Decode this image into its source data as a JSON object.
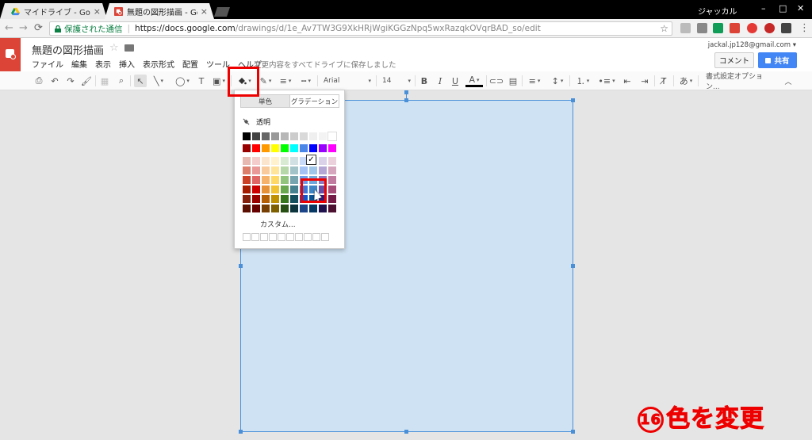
{
  "browser": {
    "tabs": [
      {
        "title": "マイドライブ - Google ドライブ",
        "active": false,
        "favicon": "drive-icon"
      },
      {
        "title": "無題の図形描画 - Google ドロー",
        "active": true,
        "favicon": "drawings-icon"
      }
    ],
    "window_user": "ジャッカル",
    "secure_label": "保護された通信",
    "url_host": "https://docs.google.com",
    "url_path": "/drawings/d/1e_Av7TW3G9XkHRjWgiKGGzNpq5wxRazqkOVqrBAD_so/edit",
    "extension_badges": [
      "2",
      "4"
    ]
  },
  "app": {
    "title": "無題の図形描画",
    "menu": [
      "ファイル",
      "編集",
      "表示",
      "挿入",
      "表示形式",
      "配置",
      "ツール",
      "ヘルプ"
    ],
    "save_status": "変更内容をすべてドライブに保存しました",
    "account": "jackal.jp128@gmail.com",
    "comment_label": "コメント",
    "share_label": "共有"
  },
  "toolbar": {
    "font_name": "Arial",
    "font_size": "14",
    "bold": "B",
    "italic": "I",
    "underline": "U",
    "text_color": "A",
    "input_tools": "あ",
    "format_options": "書式設定オプション..."
  },
  "color_menu": {
    "tabs": [
      "単色",
      "グラデーション"
    ],
    "transparent_label": "透明",
    "custom_label": "カスタム...",
    "check_mark": "✓",
    "rows": [
      [
        "#000000",
        "#434343",
        "#666666",
        "#999999",
        "#b7b7b7",
        "#cccccc",
        "#d9d9d9",
        "#efefef",
        "#f3f3f3",
        "#ffffff"
      ],
      [
        "#980000",
        "#ff0000",
        "#ff9900",
        "#ffff00",
        "#00ff00",
        "#00ffff",
        "#4a86e8",
        "#0000ff",
        "#9900ff",
        "#ff00ff"
      ],
      [
        "#e6b8af",
        "#f4cccc",
        "#fce5cd",
        "#fff2cc",
        "#d9ead3",
        "#d0e0e3",
        "#c9daf8",
        "#cfe2f3",
        "#d9d2e9",
        "#ead1dc"
      ],
      [
        "#dd7e6b",
        "#ea9999",
        "#f9cb9c",
        "#ffe599",
        "#b6d7a8",
        "#a2c4c9",
        "#a4c2f4",
        "#9fc5e8",
        "#b4a7d6",
        "#d5a6bd"
      ],
      [
        "#cc4125",
        "#e06666",
        "#f6b26b",
        "#ffd966",
        "#93c47d",
        "#76a5af",
        "#6d9eeb",
        "#6fa8dc",
        "#8e7cc3",
        "#c27ba0"
      ],
      [
        "#a61c00",
        "#cc0000",
        "#e69138",
        "#f1c232",
        "#6aa84f",
        "#45818e",
        "#3c78d8",
        "#3d85c6",
        "#674ea7",
        "#a64d79"
      ],
      [
        "#85200c",
        "#990000",
        "#b45f06",
        "#bf9000",
        "#38761d",
        "#134f5c",
        "#1155cc",
        "#0b5394",
        "#351c75",
        "#741b47"
      ],
      [
        "#5b0f00",
        "#660000",
        "#783f04",
        "#7f6000",
        "#274e13",
        "#0c343d",
        "#1c4587",
        "#073763",
        "#20124d",
        "#4c1130"
      ]
    ]
  },
  "canvas": {
    "shape_fill": "#cfe2f3",
    "shape_border": "#4a90d9"
  },
  "annotation": {
    "step_number": "16",
    "caption": "色を変更",
    "color": "#ee0000"
  }
}
